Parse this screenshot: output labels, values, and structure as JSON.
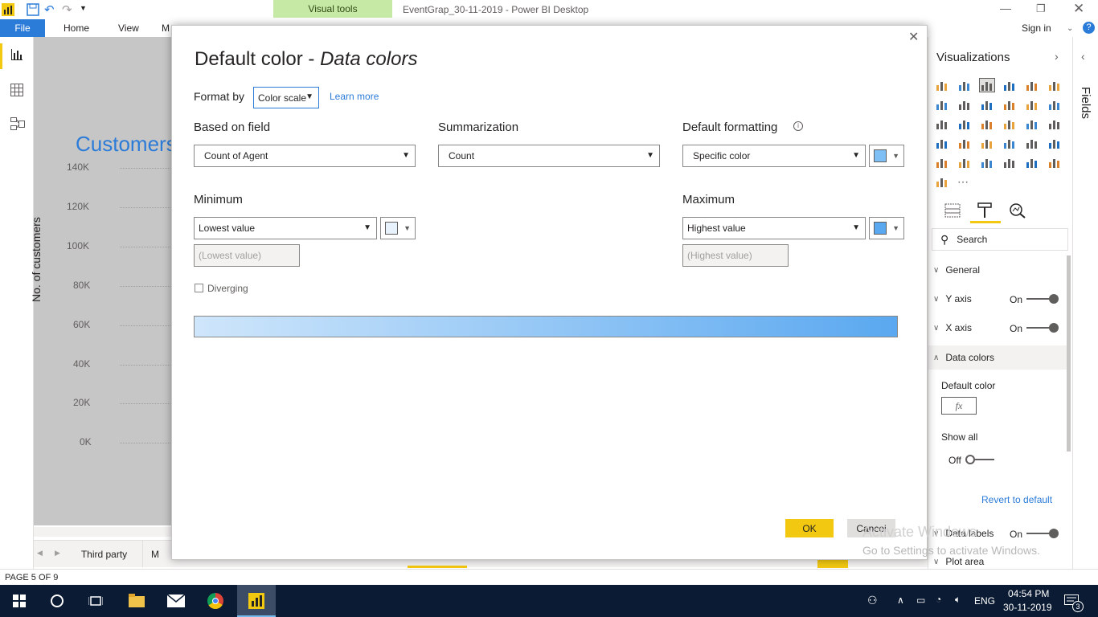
{
  "window": {
    "title": "EventGrap_30-11-2019 - Power BI Desktop",
    "contextual_tab": "Visual tools",
    "sign_in": "Sign in"
  },
  "ribbon": {
    "tabs": [
      "File",
      "Home",
      "View",
      "M"
    ]
  },
  "canvas": {
    "chart_title": "Customers",
    "y_axis_label": "No. of customers",
    "y_ticks": [
      "140K",
      "120K",
      "100K",
      "80K",
      "60K",
      "40K",
      "20K",
      "0K"
    ]
  },
  "page_tabs": [
    "Third party",
    "M"
  ],
  "status": {
    "page": "PAGE 5 OF 9"
  },
  "dialog": {
    "title_main": "Default color - ",
    "title_italic": "Data colors",
    "format_by_label": "Format by",
    "format_by_value": "Color scale",
    "learn_more": "Learn more",
    "based_on_field_label": "Based on field",
    "based_on_field_value": "Count of Agent",
    "summarization_label": "Summarization",
    "summarization_value": "Count",
    "default_formatting_label": "Default formatting",
    "default_formatting_value": "Specific color",
    "minimum_label": "Minimum",
    "minimum_value": "Lowest value",
    "minimum_input_placeholder": "(Lowest value)",
    "maximum_label": "Maximum",
    "maximum_value": "Highest value",
    "maximum_input_placeholder": "(Highest value)",
    "diverging_label": "Diverging",
    "ok_label": "OK",
    "cancel_label": "Cancel",
    "colors": {
      "min_swatch": "#e8f2fc",
      "max_swatch": "#5aa8f0",
      "default_swatch": "#7ec0f5",
      "gradient_start": "#cfe6fb",
      "gradient_end": "#5aa8f0"
    }
  },
  "right_pane": {
    "title": "Visualizations",
    "fields_label": "Fields",
    "search_placeholder": "Search",
    "sections": [
      {
        "label": "General",
        "toggle": ""
      },
      {
        "label": "Y axis",
        "toggle": "On"
      },
      {
        "label": "X axis",
        "toggle": "On"
      },
      {
        "label": "Data colors",
        "toggle": ""
      }
    ],
    "default_color_label": "Default color",
    "fx_label": "fx",
    "show_all_label": "Show all",
    "show_all_toggle": "Off",
    "revert_label": "Revert to default",
    "data_labels_label": "Data labels",
    "data_labels_toggle": "On",
    "plot_area_label": "Plot area"
  },
  "watermark": {
    "line1": "Activate Windows",
    "line2": "Go to Settings to activate Windows."
  },
  "taskbar": {
    "language": "ENG",
    "time": "04:54 PM",
    "date": "30-11-2019",
    "notification_count": "3"
  }
}
